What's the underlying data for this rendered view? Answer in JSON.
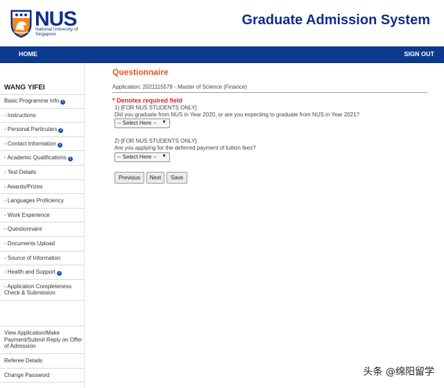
{
  "header": {
    "logo_text": "NUS",
    "logo_subtitle": "National University of Singapore",
    "title": "Graduate Admission System",
    "brand_color": "#0b2f8a",
    "crest_icon": "nus-crest-lion-icon"
  },
  "nav": {
    "home": "HOME",
    "signout": "SIGN OUT",
    "bar_color": "#0b3a8f"
  },
  "sidebar": {
    "user_name": "WANG YIFEI",
    "items": [
      {
        "label": "Basic Programme Info",
        "info": true
      },
      {
        "label": "- Instructions",
        "info": false
      },
      {
        "label": "- Personal Particulars",
        "info": true
      },
      {
        "label": "- Contact Information",
        "info": true
      },
      {
        "label": "- Academic Qualifications",
        "info": true
      },
      {
        "label": "- Test Details",
        "info": false
      },
      {
        "label": "- Awards/Prizes",
        "info": false
      },
      {
        "label": "- Languages Proficiency",
        "info": false
      },
      {
        "label": "- Work Experience",
        "info": false
      },
      {
        "label": "- Questionnaire",
        "info": false
      },
      {
        "label": "- Documents Upload",
        "info": false
      },
      {
        "label": "- Source of Information",
        "info": false
      },
      {
        "label": "- Health and Support",
        "info": true
      },
      {
        "label": "- Application Completeness Check & Submission",
        "info": false
      }
    ],
    "bottom_items": [
      {
        "label": "View Application/Make Payment/Submit Reply on Offer of Admission"
      },
      {
        "label": "Referee Details"
      },
      {
        "label": "Change Password"
      }
    ],
    "info_icon": "info-icon"
  },
  "main": {
    "title": "Questionnaire",
    "title_color": "#e4561b",
    "application_line": "Application: 2021115578 - Master of Science (Finance)",
    "required_note": "* Denotes required field",
    "questions": [
      {
        "line1": "1) [FOR NUS STUDENTS ONLY]",
        "line2": "Did you graduate from NUS in Year 2020, or are you expecting to graduate from NUS in Year 2021?",
        "select_value": "-- Select Here --"
      },
      {
        "line1": "2) [FOR NUS STUDENTS ONLY]",
        "line2": "Are you applying for the deferred payment of tuition fees?",
        "select_value": "-- Select Here --"
      }
    ],
    "buttons": {
      "previous": "Previous",
      "next": "Next",
      "save": "Save"
    }
  },
  "watermark": "头条 @绵阳留学"
}
